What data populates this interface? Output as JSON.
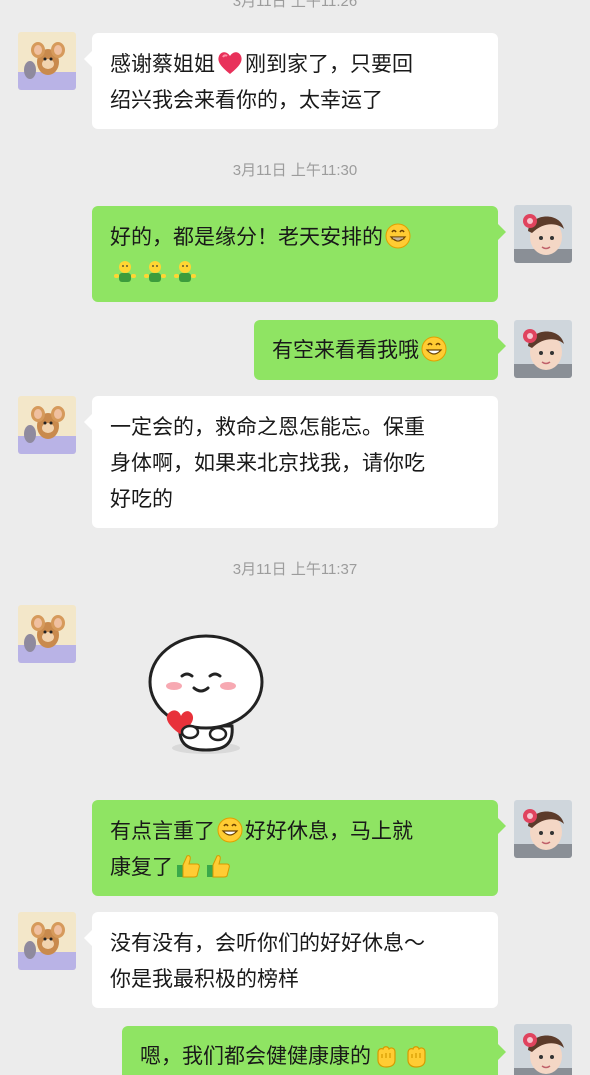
{
  "timestamps": {
    "top_partial": "3月11日 上午11:26",
    "t1": "3月11日 上午11:30",
    "t2": "3月11日 上午11:37"
  },
  "messages": {
    "m1": {
      "line1a": "感谢蔡姐姐",
      "line1b": "刚到家了，只要回",
      "line2": "绍兴我会来看你的，太幸运了"
    },
    "m2": {
      "line1": "好的，都是缘分！老天安排的"
    },
    "m3": {
      "line1": "有空来看看我哦"
    },
    "m4": {
      "line1": "一定会的，救命之恩怎能忘。保重",
      "line2": "身体啊，如果来北京找我，请你吃",
      "line3": "好吃的"
    },
    "m6": {
      "line1a": "有点言重了",
      "line1b": "好好休息，马上就",
      "line2": "康复了"
    },
    "m7": {
      "line1": "没有没有，会听你们的好好休息～",
      "line2": "你是我最积极的榜样"
    },
    "m8": {
      "line1": "嗯，我们都会健健康康的"
    }
  },
  "colors": {
    "background": "#ececec",
    "bubble_me": "#8fe463",
    "bubble_other": "#ffffff",
    "timestamp": "#9c9c9c"
  },
  "icons": {
    "avatar_other": "cartoon-mouse-avatar",
    "avatar_me": "child-with-flower-avatar",
    "sticker": "heart-holding-blob-sticker"
  }
}
